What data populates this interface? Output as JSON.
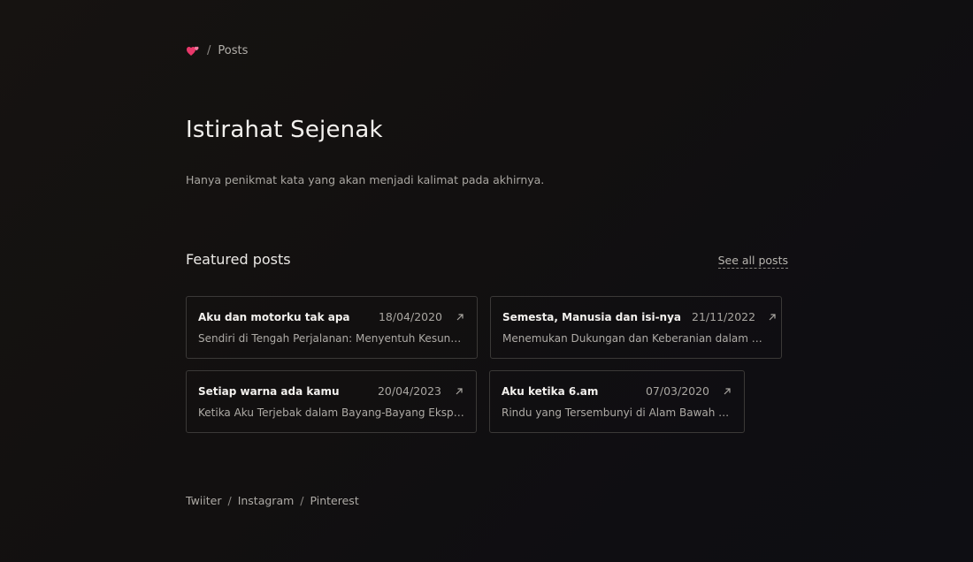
{
  "breadcrumb": {
    "home_icon": "two-hearts-icon",
    "separator": "/",
    "current": "Posts"
  },
  "page": {
    "title": "Istirahat Sejenak",
    "subtitle": "Hanya penikmat kata yang akan menjadi kalimat pada akhirnya."
  },
  "featured": {
    "heading": "Featured posts",
    "see_all_label": "See all posts",
    "posts": [
      {
        "title": "Aku dan motorku tak apa",
        "date": "18/04/2020",
        "description": "Sendiri di Tengah Perjalanan: Menyentuh Kesunyian…",
        "icon": "arrow-up-right-icon"
      },
      {
        "title": "Semesta, Manusia dan isi-nya",
        "date": "21/11/2022",
        "description": "Menemukan Dukungan dan Keberanian dalam Hidu…",
        "icon": "arrow-up-right-icon"
      },
      {
        "title": "Setiap warna ada kamu",
        "date": "20/04/2023",
        "description": "Ketika Aku Terjebak dalam Bayang-Bayang Ekspektasi",
        "icon": "arrow-up-right-icon"
      },
      {
        "title": "Aku ketika 6.am",
        "date": "07/03/2020",
        "description": "Rindu yang Tersembunyi di Alam Bawah Sadar",
        "icon": "arrow-up-right-icon"
      }
    ]
  },
  "footer": {
    "links": [
      "Twiiter",
      "Instagram",
      "Pinterest"
    ],
    "separator": "/"
  },
  "colors": {
    "background": "#131111",
    "card_border": "#3b3937",
    "heart_accent": "#e8386a"
  }
}
